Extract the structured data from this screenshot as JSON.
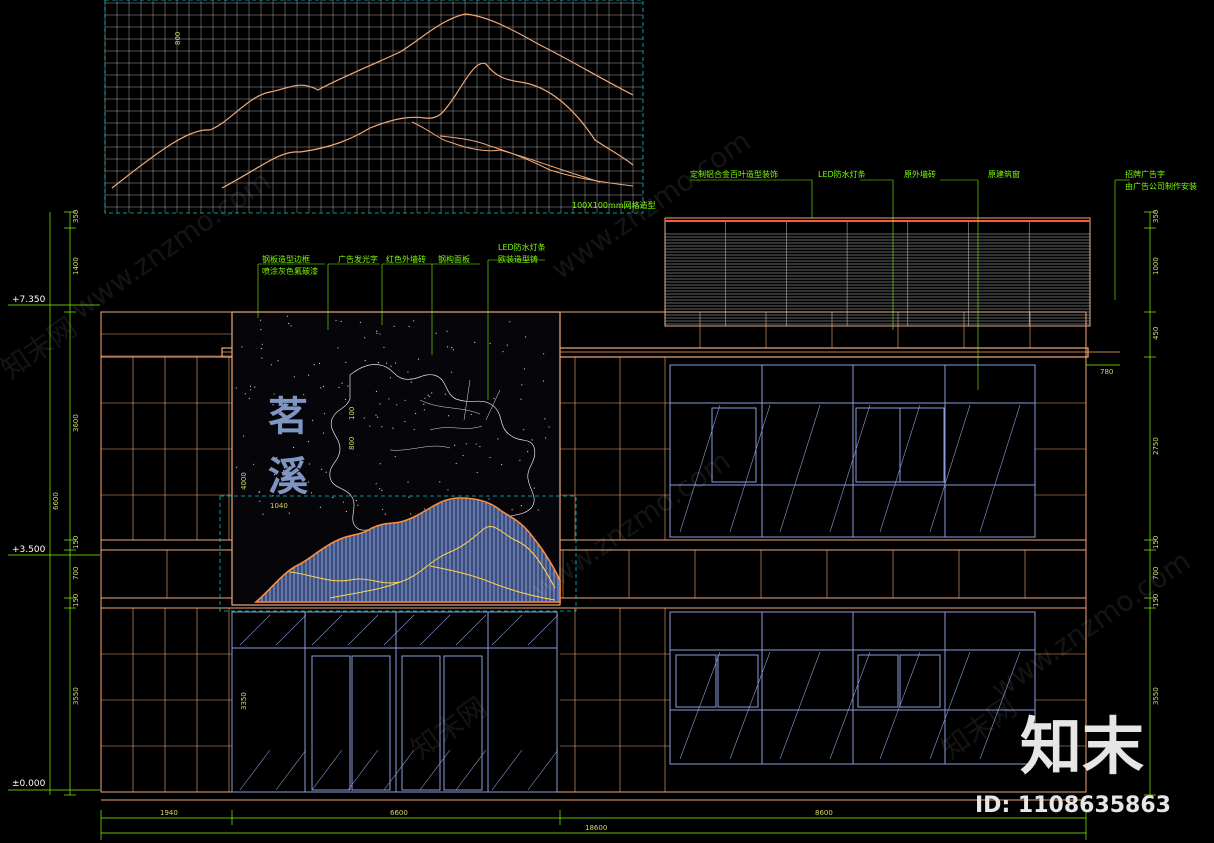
{
  "annotations": {
    "steel_frame": "钢板造型边框",
    "stone_coating": "喷涂灰色氟碳漆",
    "ad_glow_text": "广告发光字",
    "red_wall_tile": "红色外墙砖",
    "steel_grid": "钢构面板",
    "led_line_1": "LED防水灯条",
    "led_line_2": "欧装造型铸",
    "louver": "定制铝合金百叶造型装饰",
    "led_strip": "LED防水灯条",
    "exterior_tile": "原外墙砖",
    "orig_window": "原建筑窗",
    "ad_text_1": "招牌广告字",
    "ad_text_2": "由广告公司制作安装",
    "grid_note": "100X100mm网格造型"
  },
  "sign": {
    "char_1": "茗",
    "char_2": "溪"
  },
  "levels": {
    "top": "+7.350",
    "mid": "+3.500",
    "ground": "±0.000"
  },
  "dimensions": {
    "left_1": "350",
    "left_2": "1400",
    "left_3": "3600",
    "left_4": "6600",
    "left_5": "150",
    "left_6": "700",
    "left_7": "150",
    "left_8": "3550",
    "bottom_1": "1940",
    "bottom_2": "6600",
    "bottom_3": "8600",
    "bottom_total": "18600",
    "right_1": "350",
    "right_2": "1000",
    "right_3": "450",
    "right_4": "2750",
    "right_5": "150",
    "right_6": "700",
    "right_7": "150",
    "right_8": "3550",
    "sign_h": "4000",
    "sign_w": "1040",
    "sign_a": "800",
    "sign_b": "100",
    "door_h": "3350",
    "overhang": "780",
    "panel": "800"
  },
  "watermark": {
    "logo": "知末",
    "id": "ID: 1108635863",
    "site": "www.znzmo.com",
    "site_cn": "知末网"
  },
  "colors": {
    "background": "#000000",
    "annotation": "#7CFC00",
    "facade_line": "#f0a878",
    "window_line": "#8a9bd8",
    "dimension": "#d6d66a",
    "grid": "#c8c8c8",
    "dashed": "#00c8c8",
    "mountain": "#ff8c3a",
    "mountain_fill": "#7f95c2"
  }
}
